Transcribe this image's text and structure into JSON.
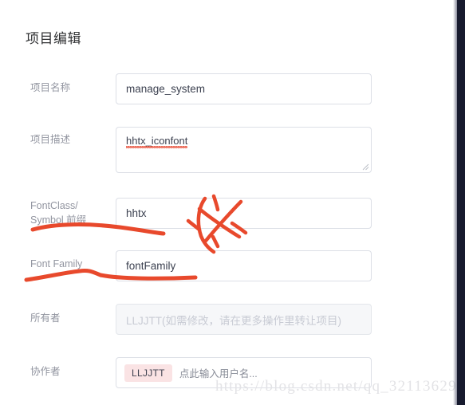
{
  "dialog": {
    "title": "项目编辑"
  },
  "form": {
    "project_name": {
      "label": "项目名称",
      "value": "manage_system"
    },
    "project_description": {
      "label": "项目描述",
      "value": "hhtx_iconfont"
    },
    "font_class_prefix": {
      "label_line1": "FontClass/",
      "label_line2": "Symbol 前缀",
      "value": "hhtx"
    },
    "font_family": {
      "label": "Font Family",
      "value": "fontFamily"
    },
    "owner": {
      "label": "所有者",
      "placeholder": "LLJJTT(如需修改，请在更多操作里转让项目)",
      "disabled": true
    },
    "collaborator": {
      "label": "协作者",
      "tags": [
        "LLJJTT"
      ],
      "placeholder": "点此输入用户名..."
    }
  },
  "annotations": {
    "color": "#e8492c",
    "marks": [
      "underline-fontclass-prefix",
      "cross-out-mark",
      "underline-font-family"
    ]
  },
  "watermark": {
    "text": "https://blog.csdn.net/qq_32113629"
  },
  "colors": {
    "border": "#dcdfe6",
    "label": "#9295a0",
    "text": "#3c4150",
    "tag_bg": "#fae3e4",
    "annotation": "#e8492c",
    "backdrop": "#171a2e"
  }
}
